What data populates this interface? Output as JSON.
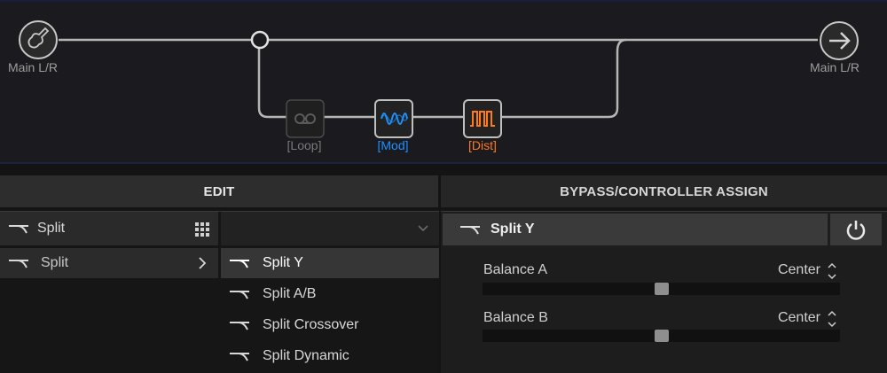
{
  "chain": {
    "input_label": "Main L/R",
    "output_label": "Main L/R",
    "blocks": [
      {
        "label": "[Loop]",
        "color": "#7a7a7a",
        "icon": "loop-icon"
      },
      {
        "label": "[Mod]",
        "color": "#1e90ff",
        "icon": "mod-wave-icon"
      },
      {
        "label": "[Dist]",
        "color": "#ff7a1a",
        "icon": "dist-square-wave-icon"
      }
    ]
  },
  "tabs": {
    "edit": "EDIT",
    "bypass": "BYPASS/CONTROLLER ASSIGN"
  },
  "edit": {
    "category_header": "Split",
    "category_selected": "Split",
    "models": [
      "Split Y",
      "Split A/B",
      "Split Crossover",
      "Split Dynamic"
    ],
    "selected_model": "Split Y"
  },
  "params": {
    "header": "Split Y",
    "items": [
      {
        "label": "Balance A",
        "value": "Center",
        "level": 0.5
      },
      {
        "label": "Balance B",
        "value": "Center",
        "level": 0.5
      }
    ]
  }
}
